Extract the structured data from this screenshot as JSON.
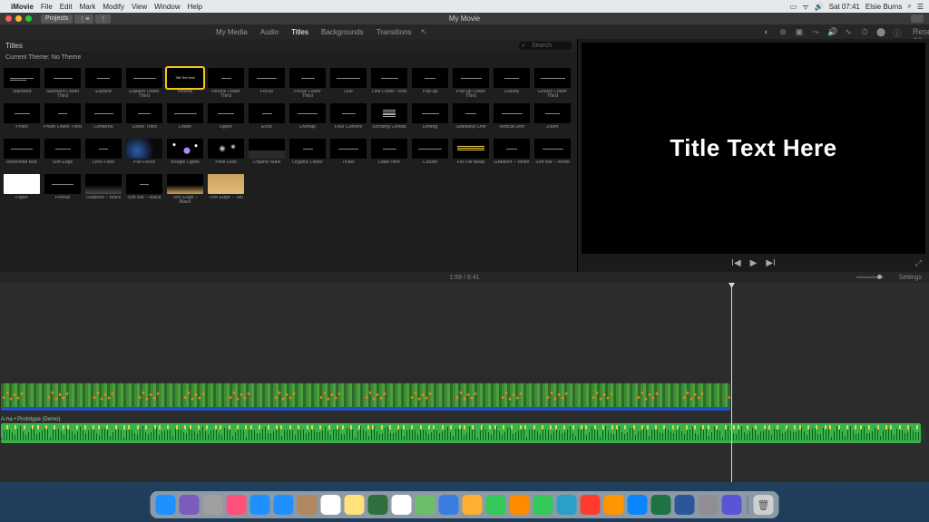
{
  "menubar": {
    "app": "iMovie",
    "items": [
      "File",
      "Edit",
      "Mark",
      "Modify",
      "View",
      "Window",
      "Help"
    ],
    "right": {
      "time": "Sat 07:41",
      "user": "Elsie Burns"
    }
  },
  "window": {
    "title": "My Movie",
    "projects_btn": "Projects"
  },
  "tabs": {
    "items": [
      "My Media",
      "Audio",
      "Titles",
      "Backgrounds",
      "Transitions"
    ],
    "active_index": 2,
    "reset": "Reset All"
  },
  "browser": {
    "header": "Titles",
    "search_placeholder": "Search",
    "theme_line": "Current Theme: No Theme",
    "selected_index": 4,
    "titles": [
      [
        "Standard",
        "Standard Lower Third",
        "Expand",
        "Expand Lower Third",
        "Reveal",
        "Reveal Lower Third",
        "Focus",
        "Focus Lower Third",
        "Line",
        "Line Lower Third",
        "Pop-up",
        "Pop-up Lower Third",
        "Gravity",
        "Gravity Lower Third"
      ],
      [
        "Prism",
        "Prism Lower Third",
        "Centered",
        "Lower Third",
        "Lower",
        "Upper",
        "Echo",
        "Overlap",
        "Four Corners",
        "Scrolling Credits",
        "Drifting",
        "Sideways Drift",
        "Vertical Drift",
        "Zoom"
      ],
      [
        "Horizontal Blur",
        "Soft Edge",
        "Lens Flare",
        "Pull Focus",
        "Boogie Lights",
        "Pixie Dust",
        "Organic Main",
        "Organic Lower",
        "Ticker",
        "Date/Time",
        "Clouds",
        "Far Far Away",
        "Gradient – White",
        "Soft Bar – White"
      ],
      [
        "Paper",
        "Formal",
        "Gradient – Black",
        "Soft Bar – Black",
        "Torn Edge – Black",
        "Torn Edge – Tan"
      ]
    ]
  },
  "viewer": {
    "preview_text": "Title Text Here"
  },
  "timebar": {
    "position": "1:59 / 6:41",
    "settings": "Settings"
  },
  "timeline": {
    "audio_label": "A-ha • Prototype (Demo)"
  },
  "dock": {
    "apps": [
      "finder",
      "safari-compass",
      "launchpad",
      "photos",
      "safari",
      "mail",
      "contacts",
      "calendar",
      "notes",
      "clock",
      "reminders",
      "maps",
      "app1",
      "photobooth",
      "messages",
      "vlc",
      "facetime",
      "app2",
      "music",
      "books",
      "appstore",
      "excel",
      "word",
      "help",
      "imovie"
    ]
  }
}
